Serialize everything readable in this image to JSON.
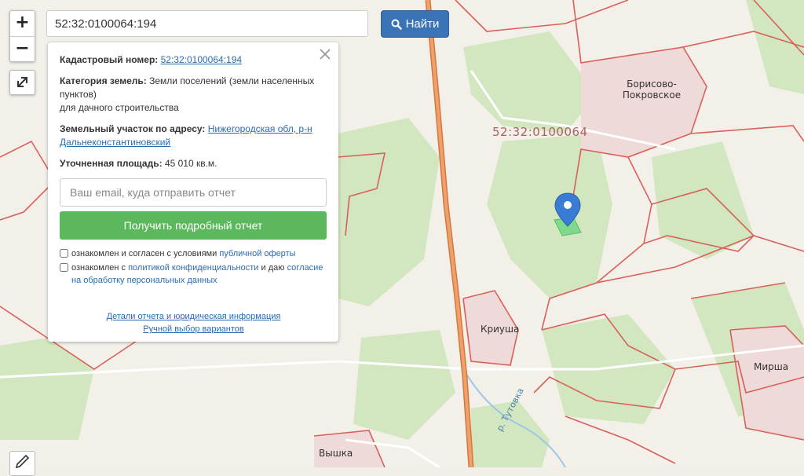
{
  "search": {
    "value": "52:32:0100064:194",
    "button_label": "Найти",
    "button_icon": "search-icon"
  },
  "zoom": {
    "in": "+",
    "out": "−"
  },
  "panel": {
    "cadastral_label": "Кадастровый номер:",
    "cadastral_value": "52:32:0100064:194",
    "category_label": "Категория земель:",
    "category_value": "Земли поселений (земли населенных пунктов)",
    "category_use": "для дачного строительства",
    "address_label": "Земельный участок по адресу:",
    "address_value": "Нижегородская обл, р-н Дальнеконстантиновский",
    "area_label": "Уточненная площадь:",
    "area_value": "45 010 кв.м.",
    "email_placeholder": "Ваш email, куда отправить отчет",
    "report_button": "Получить подробный отчет",
    "offer_text": "ознакомлен и согласен с условиями",
    "offer_link": "публичной оферты",
    "privacy_text": "ознакомлен с",
    "privacy_link": "политикой конфиденциальности",
    "privacy_and": "и даю",
    "consent_link": "согласие на обработку персональных данных",
    "details_link": "Детали отчета и юридическая информация",
    "manual_link": "Ручной выбор вариантов"
  },
  "map": {
    "quarter_label": "52:32:0100064",
    "places": [
      "Борисово-Покровское",
      "Криуша",
      "Мирша",
      "Вышка",
      "р. Тутовка"
    ]
  },
  "colors": {
    "road": "#e8915a",
    "parcel_border": "#d9605a",
    "forest": "#cde6b8",
    "search_button": "#3a73b6",
    "report_button": "#5cb85c",
    "marker": "#3a7bd5"
  }
}
